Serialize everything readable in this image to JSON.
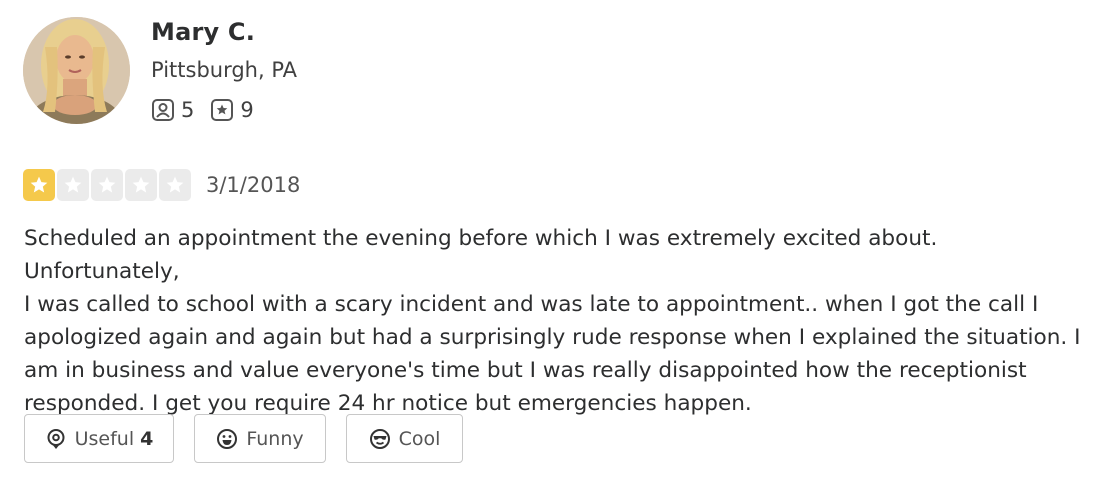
{
  "reviewer": {
    "name": "Mary C.",
    "location": "Pittsburgh, PA",
    "friends_count": "5",
    "reviews_count": "9",
    "avatar_alt": "profile photo"
  },
  "review": {
    "rating": 1,
    "max_rating": 5,
    "date": "3/1/2018",
    "text": "Scheduled an appointment the evening before which I was extremely excited about.  Unfortunately,\nI was called to school with a scary incident and was late to appointment.. when I got the call I\napologized again and again but had a surprisingly rude response when I explained the situation. I\nam in business and value everyone's time but I was really disappointed how the receptionist\nresponded. I get you require 24 hr notice but emergencies happen."
  },
  "votes": {
    "useful_label": "Useful",
    "useful_count": "4",
    "funny_label": "Funny",
    "cool_label": "Cool"
  },
  "colors": {
    "star_active": "#f5c94b",
    "star_inactive": "#ebebeb"
  },
  "icons": {
    "friends": "friends-icon",
    "reviews": "review-star-icon",
    "useful": "useful-bulb-icon",
    "funny": "funny-face-icon",
    "cool": "cool-sunglasses-icon"
  }
}
